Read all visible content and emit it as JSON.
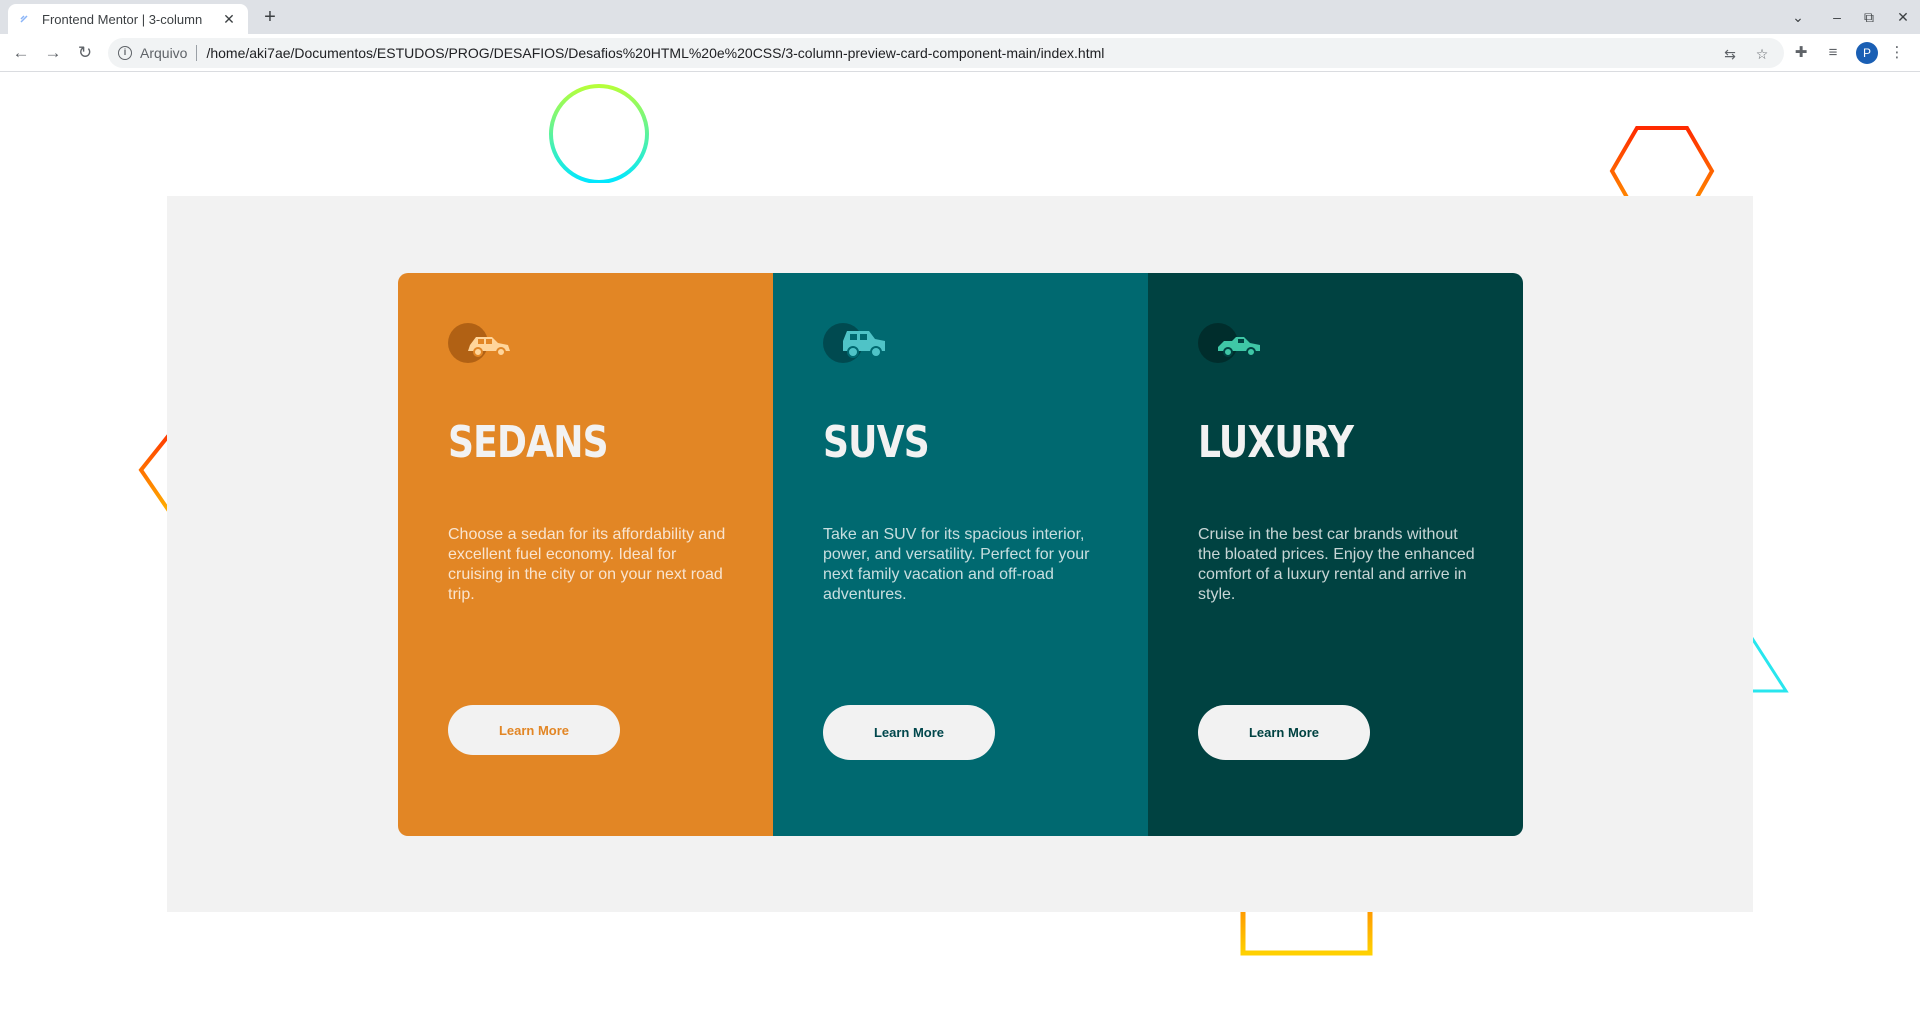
{
  "browser": {
    "tab_title": "Frontend Mentor | 3-column",
    "tab_close": "✕",
    "new_tab": "+",
    "scheme": "Arquivo",
    "url": "/home/aki7ae/Documentos/ESTUDOS/PROG/DESAFIOS/Desafios%20HTML%20e%20CSS/3-column-preview-card-component-main/index.html",
    "profile_initial": "P"
  },
  "cards": [
    {
      "title": "SEDANS",
      "text": "Choose a sedan for its affordability and excellent fuel economy. Ideal for cruising in the city or on your next road trip.",
      "button": "Learn More",
      "icon": "sedan-car-icon",
      "background": "#e28625",
      "accent": "#e28625"
    },
    {
      "title": "SUVS",
      "text": "Take an SUV for its spacious interior, power, and versatility. Perfect for your next family vacation and off-road adventures.",
      "button": "Learn More",
      "icon": "suv-car-icon",
      "background": "#006970",
      "accent": "#006970"
    },
    {
      "title": "LUXURY",
      "text": "Cruise in the best car brands without the bloated prices. Enjoy the enhanced comfort of a luxury rental and arrive in style.",
      "button": "Learn More",
      "icon": "luxury-car-icon",
      "background": "#004241",
      "accent": "#004241"
    }
  ],
  "colors": {
    "panel": "#f2f2f2",
    "button_bg": "#f2f2f2"
  }
}
